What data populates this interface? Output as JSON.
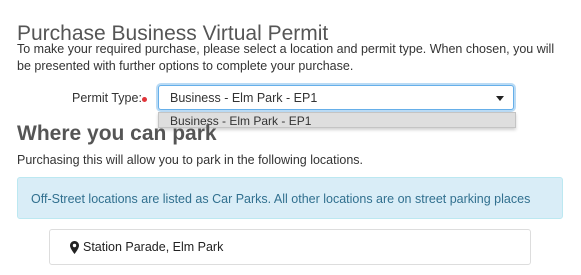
{
  "page": {
    "title": "Purchase Business Virtual Permit",
    "intro": "To make your required purchase, please select a location and permit type. When chosen, you will be presented with further options to complete your purchase."
  },
  "permit_form": {
    "label": "Permit Type:",
    "selected": "Business - Elm Park - EP1",
    "options": [
      "Business - Elm Park - EP1"
    ],
    "required_color": "#e0343a",
    "caret_icon": "chevron-down-icon"
  },
  "where": {
    "title": "Where you can park",
    "description": "Purchasing this will allow you to park in the following locations.",
    "info": "Off-Street locations are listed as Car Parks. All other locations are on street parking places",
    "locations": [
      {
        "name": "Station Parade, Elm Park",
        "icon": "map-marker-icon"
      }
    ]
  }
}
